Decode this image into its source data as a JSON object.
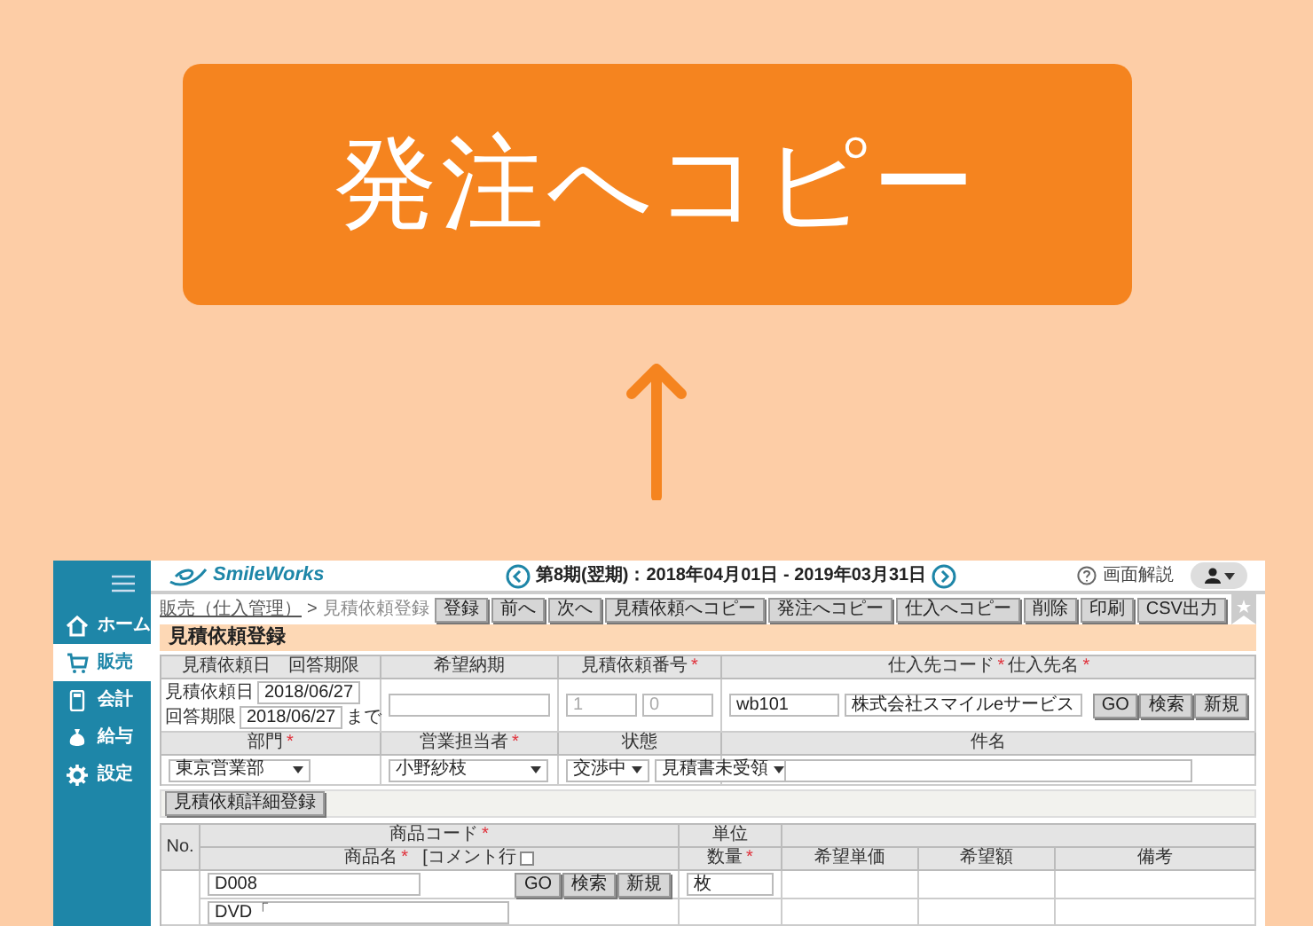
{
  "banner": {
    "title": "発注へコピー"
  },
  "app": {
    "sidebar": {
      "items": [
        {
          "kind": "home",
          "label": "ホーム",
          "selected": false
        },
        {
          "kind": "cart",
          "label": "販売",
          "selected": true
        },
        {
          "kind": "calc",
          "label": "会計",
          "selected": false
        },
        {
          "kind": "bag",
          "label": "給与",
          "selected": false
        },
        {
          "kind": "gear",
          "label": "設定",
          "selected": false
        }
      ]
    },
    "header": {
      "logo": "SmileWorks",
      "period": "第8期(翌期)：2018年04月01日 - 2019年03月31日",
      "help": "画面解説"
    },
    "breadcrumb": {
      "link": "販売（仕入管理）",
      "separator": ">",
      "current": "見積依頼登録"
    },
    "toolbar": [
      "登録",
      "前へ",
      "次へ",
      "見積依頼へコピー",
      "発注へコピー",
      "仕入へコピー",
      "削除",
      "印刷",
      "CSV出力"
    ],
    "page_title": "見積依頼登録",
    "form": {
      "headers_1": [
        {
          "label": "見積依頼日　回答期限"
        },
        {
          "label": "希望納期"
        },
        {
          "label": "見積依頼番号",
          "mark": "*"
        },
        {
          "label": "仕入先コード",
          "mark": "*",
          "label_2": "仕入先名",
          "mark_2": "*"
        }
      ],
      "request_date_label": "見積依頼日",
      "request_date": "2018/06/27",
      "answer_label": "回答期限",
      "answer_date": "2018/06/27",
      "answer_suffix": "まで",
      "request_no": [
        "1",
        "0"
      ],
      "supplier_code": "wb101",
      "supplier_name": "株式会社スマイルeサービス",
      "supplier_buttons": [
        "GO",
        "検索",
        "新規"
      ],
      "headers_2": [
        {
          "label": "部門",
          "mark": "*"
        },
        {
          "label": "営業担当者",
          "mark": "*"
        },
        {
          "label": "状態"
        },
        {
          "label": "件名"
        }
      ],
      "department": "東京営業部",
      "staff": "小野紗枝",
      "status": "交渉中",
      "status_2": "見積書未受領"
    },
    "detail_button": "見積依頼詳細登録",
    "items": {
      "no_header": "No.",
      "code_header": "商品コード",
      "code_mark": "*",
      "name_header": "商品名",
      "name_mark": "*",
      "comment_label": "[コメント行",
      "comment_checked": false,
      "unit_header": "単位",
      "qty_header": "数量",
      "qty_mark": "*",
      "columns": [
        "希望単価",
        "希望額",
        "備考"
      ],
      "row": {
        "code": "D008",
        "buttons": [
          "GO",
          "検索",
          "新規"
        ],
        "unit": "枚",
        "name": "DVD「"
      }
    }
  }
}
